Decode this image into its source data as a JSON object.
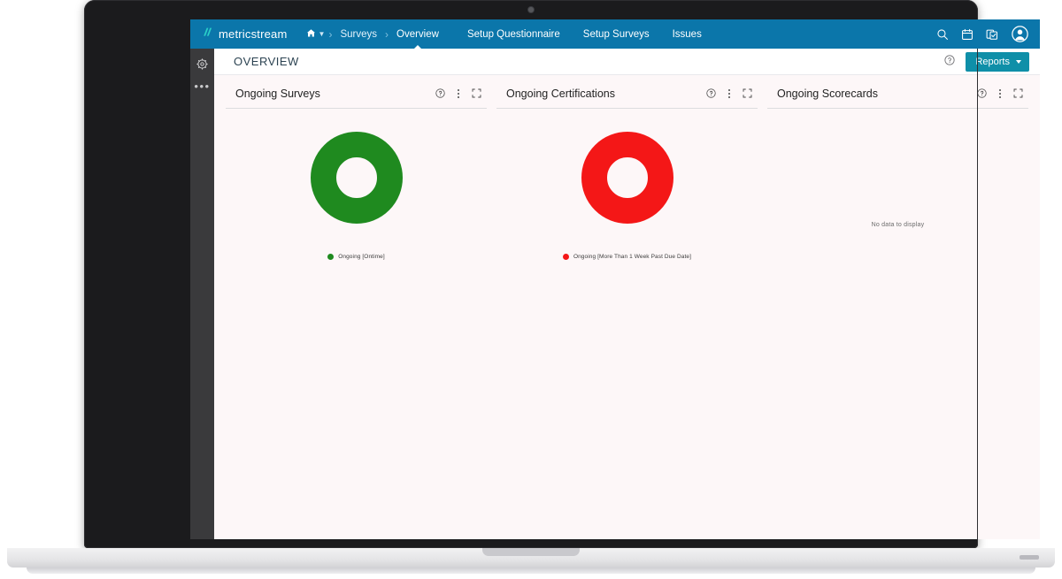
{
  "colors": {
    "top_nav_bg": "#0b76aa",
    "sidebar_bg": "#3a3a3c",
    "accent_button": "#0f8fa8",
    "brand_mark": "#2ad0c8",
    "page_bg": "#fdf7f8",
    "ongoing_ontime_green": "#1f8a1f",
    "past_due_red": "#f41717"
  },
  "top_nav": {
    "brand_name": "metricstream",
    "brand_mark_icon": "metricstream-logo-icon",
    "breadcrumb": {
      "home_icon": "home-icon",
      "home_caret_icon": "chevron-down-icon",
      "separator": "›",
      "items": [
        {
          "label": "Surveys",
          "active": false
        },
        {
          "label": "Overview",
          "active": true
        }
      ]
    },
    "links": [
      {
        "label": "Setup Questionnaire"
      },
      {
        "label": "Setup Surveys"
      },
      {
        "label": "Issues"
      }
    ],
    "actions": [
      {
        "name": "search-icon",
        "title": "Search"
      },
      {
        "name": "calendar-icon",
        "title": "Calendar"
      },
      {
        "name": "tasks-icon",
        "title": "Tasks"
      },
      {
        "name": "user-avatar-icon",
        "title": "Account"
      }
    ]
  },
  "sidebar": {
    "items": [
      {
        "name": "settings-gear-icon",
        "label": "Settings"
      },
      {
        "name": "more-options-icon",
        "label": "•••"
      }
    ]
  },
  "page_header": {
    "title": "OVERVIEW",
    "help_icon": "help-circle-icon",
    "reports_label": "Reports",
    "reports_caret_icon": "caret-down-icon"
  },
  "widget_tools": {
    "info_icon": "info-circle-icon",
    "menu_icon": "kebab-menu-icon",
    "expand_icon": "expand-fullscreen-icon"
  },
  "widgets": [
    {
      "id": "ongoing-surveys",
      "title": "Ongoing Surveys",
      "has_data": true
    },
    {
      "id": "ongoing-certifications",
      "title": "Ongoing Certifications",
      "has_data": true
    },
    {
      "id": "ongoing-scorecards",
      "title": "Ongoing Scorecards",
      "has_data": false,
      "empty_message": "No data to display"
    }
  ],
  "chart_data": [
    {
      "type": "pie",
      "id": "ongoing-surveys-donut",
      "title": "Ongoing Surveys",
      "donut": true,
      "inner_radius_ratio": 0.46,
      "labels": [
        "Ongoing [Ontime]"
      ],
      "values": [
        100
      ],
      "unit": "%",
      "colors": [
        "#1f8a1f"
      ],
      "legend": [
        "Ongoing [Ontime]"
      ],
      "legend_position": "bottom"
    },
    {
      "type": "pie",
      "id": "ongoing-certifications-donut",
      "title": "Ongoing Certifications",
      "donut": true,
      "inner_radius_ratio": 0.46,
      "labels": [
        "Ongoing [More Than 1 Week Past Due Date]"
      ],
      "values": [
        100
      ],
      "unit": "%",
      "colors": [
        "#f41717"
      ],
      "legend": [
        "Ongoing [More Than 1 Week Past Due Date]"
      ],
      "legend_position": "bottom"
    },
    {
      "type": "pie",
      "id": "ongoing-scorecards-donut",
      "title": "Ongoing Scorecards",
      "donut": true,
      "labels": [],
      "values": [],
      "colors": [],
      "legend": [],
      "empty_message": "No data to display"
    }
  ]
}
